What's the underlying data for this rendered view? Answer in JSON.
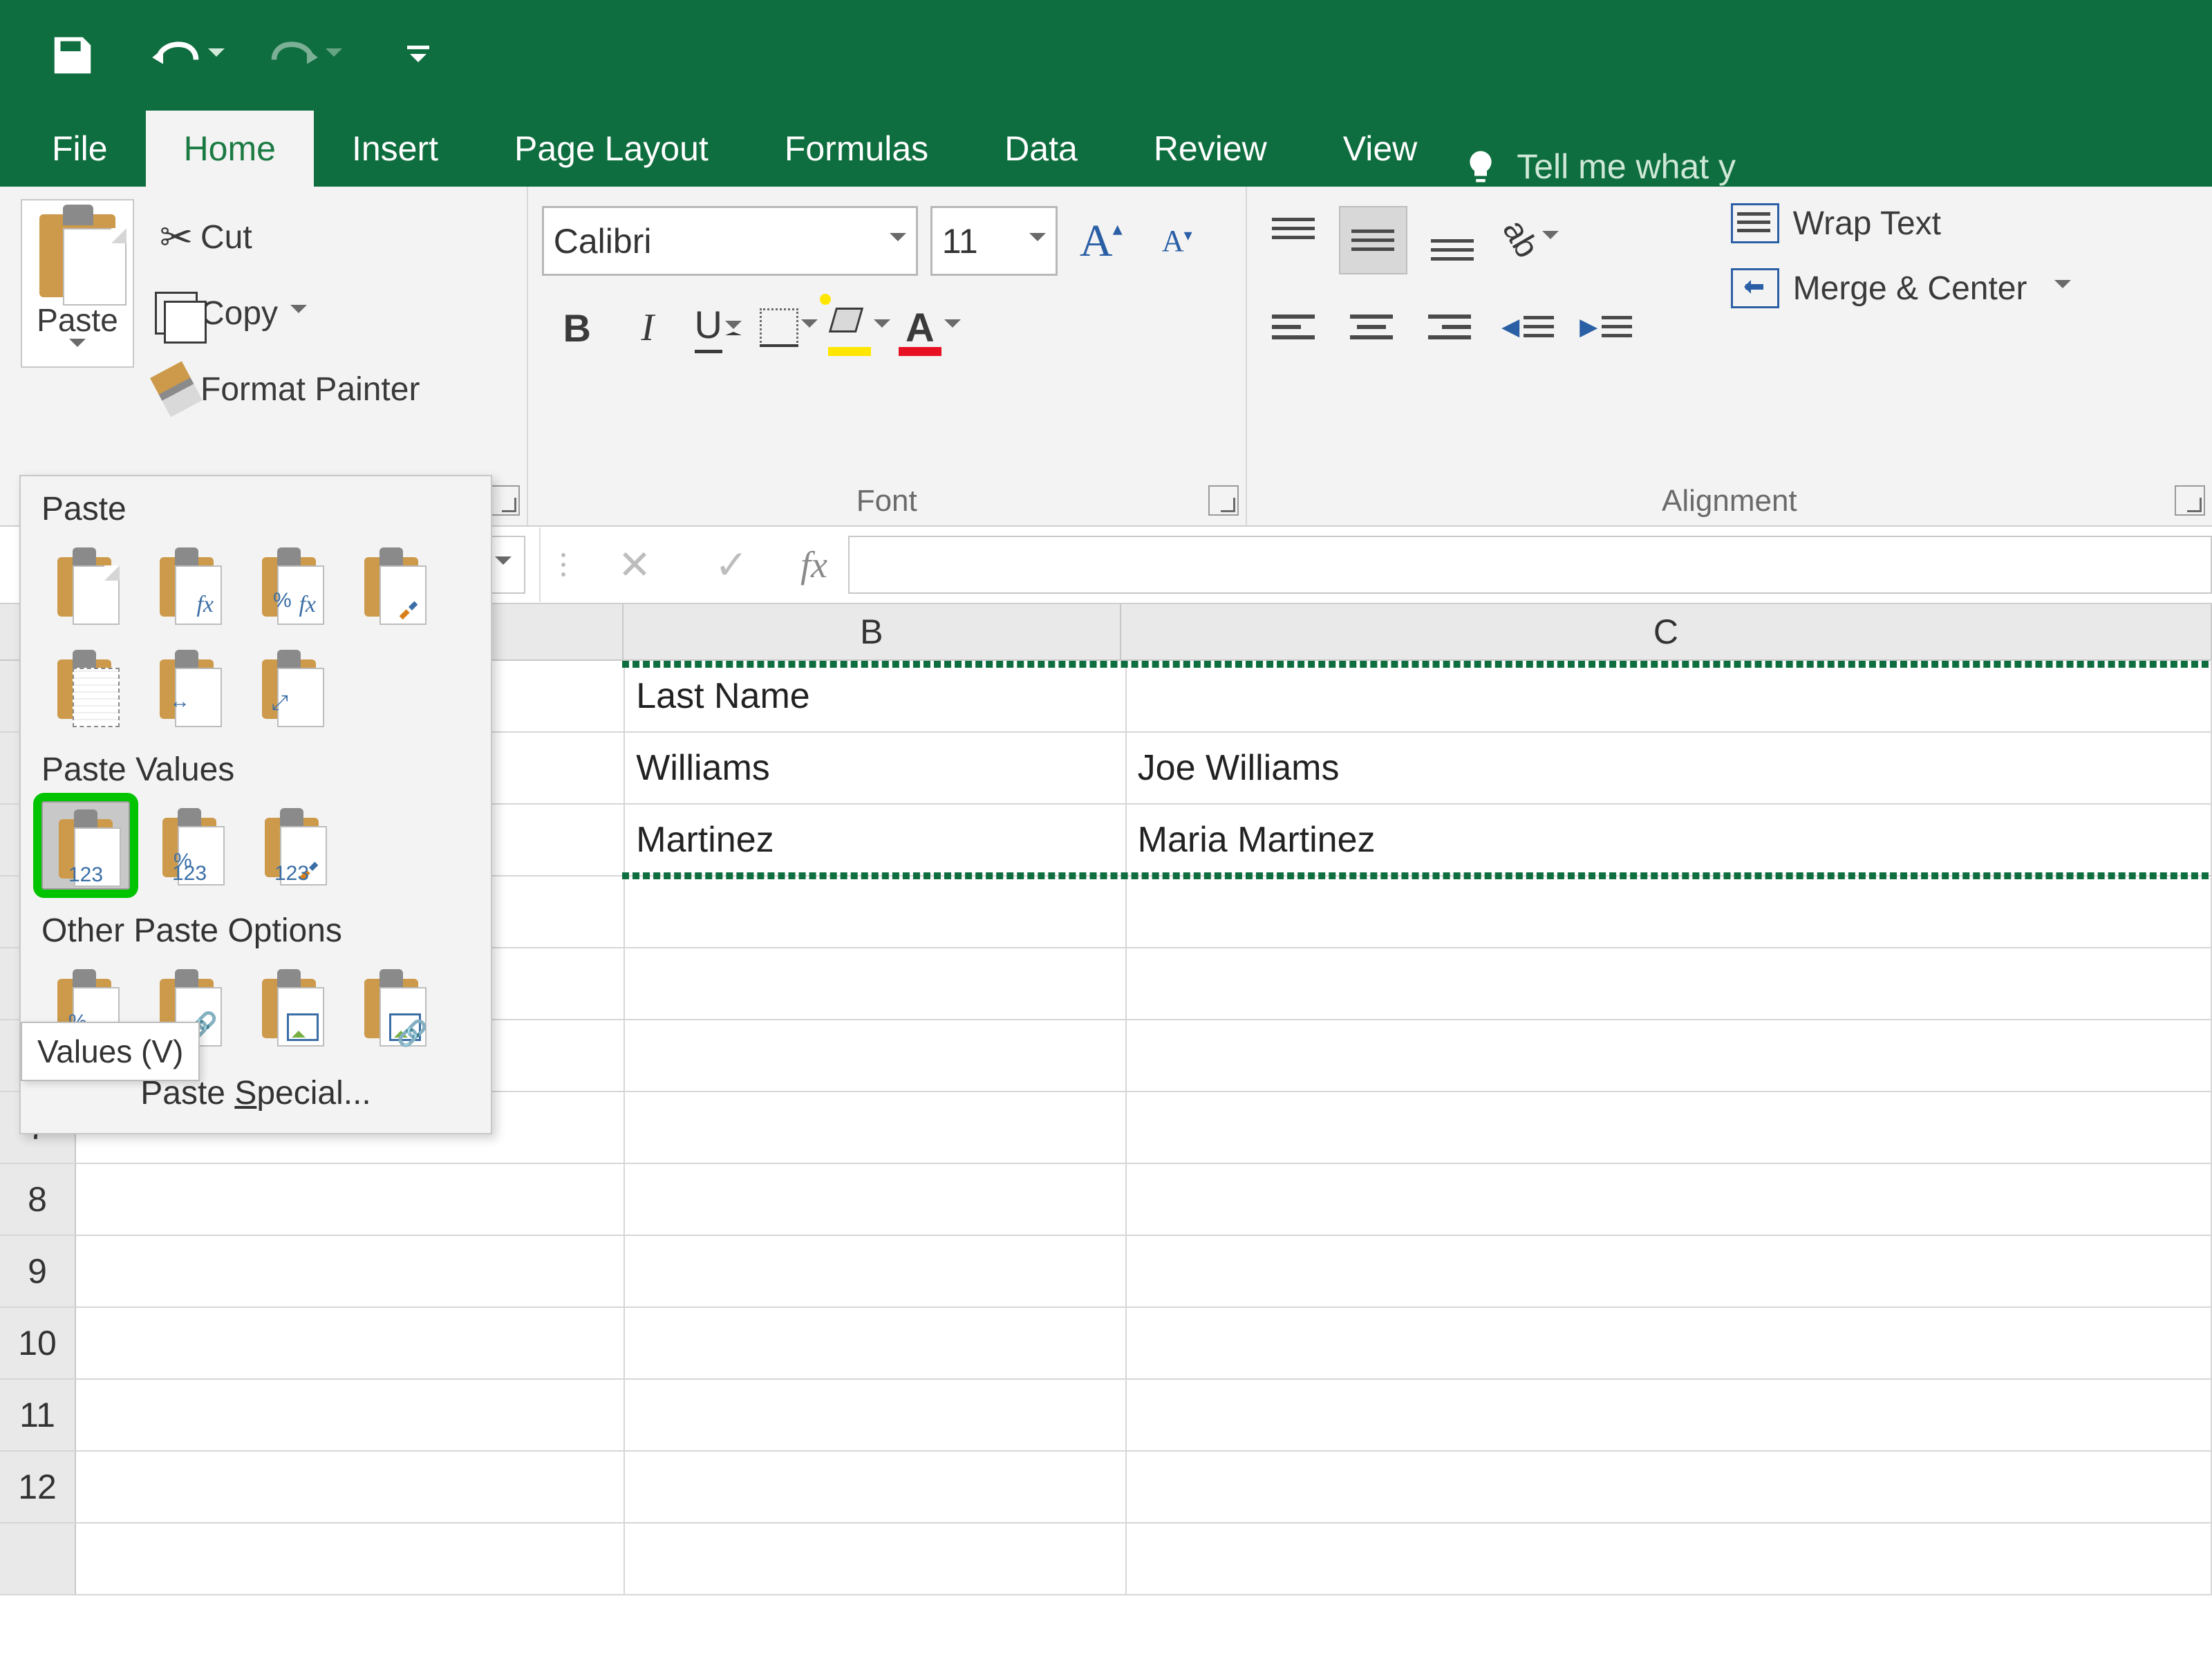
{
  "qat": {
    "save": "save",
    "undo": "undo",
    "redo": "redo"
  },
  "tabs": {
    "file": "File",
    "home": "Home",
    "insert": "Insert",
    "page_layout": "Page Layout",
    "formulas": "Formulas",
    "data": "Data",
    "review": "Review",
    "view": "View",
    "tell_me": "Tell me what y"
  },
  "ribbon": {
    "clipboard": {
      "paste": "Paste",
      "cut": "Cut",
      "copy": "Copy",
      "format_painter": "Format Painter"
    },
    "font": {
      "group_label": "Font",
      "name": "Calibri",
      "size": "11"
    },
    "alignment": {
      "group_label": "Alignment",
      "wrap": "Wrap Text",
      "merge": "Merge & Center"
    }
  },
  "paste_menu": {
    "paste_header": "Paste",
    "values_header": "Paste Values",
    "other_header": "Other Paste Options",
    "special": {
      "pre": "Paste ",
      "ul": "S",
      "post": "pecial..."
    },
    "val_sub": "123",
    "tooltip": "Values (V)"
  },
  "fx": {
    "label": "fx"
  },
  "columns": {
    "B": "B",
    "C": "C"
  },
  "rows": {
    "r7": "7",
    "r8": "8",
    "r9": "9",
    "r10": "10",
    "r11": "11",
    "r12": "12"
  },
  "cells": {
    "B1": "Last Name",
    "B2": "Williams",
    "B3": "Martinez",
    "C2": "Joe Williams",
    "C3": "Maria Martinez"
  }
}
